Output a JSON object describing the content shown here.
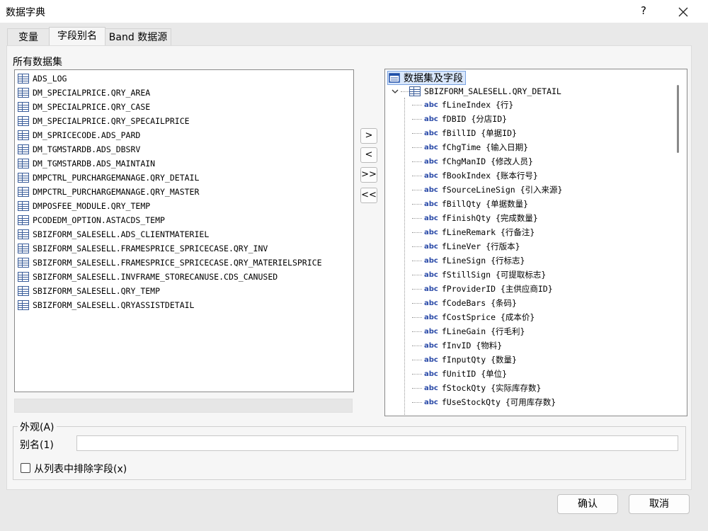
{
  "window": {
    "title": "数据字典",
    "help": "?",
    "close": "✕"
  },
  "tabs": [
    {
      "label": "变量"
    },
    {
      "label": "字段别名"
    },
    {
      "label": "Band 数据源"
    }
  ],
  "left_panel": {
    "label": "所有数据集",
    "datasets": [
      "ADS_LOG",
      "DM_SPECIALPRICE.QRY_AREA",
      "DM_SPECIALPRICE.QRY_CASE",
      "DM_SPECIALPRICE.QRY_SPECAILPRICE",
      "DM_SPRICECODE.ADS_PARD",
      "DM_TGMSTARDB.ADS_DBSRV",
      "DM_TGMSTARDB.ADS_MAINTAIN",
      "DMPCTRL_PURCHARGEMANAGE.QRY_DETAIL",
      "DMPCTRL_PURCHARGEMANAGE.QRY_MASTER",
      "DMPOSFEE_MODULE.QRY_TEMP",
      "PCODEDM_OPTION.ASTACDS_TEMP",
      "SBIZFORM_SALESELL.ADS_CLIENTMATERIEL",
      "SBIZFORM_SALESELL.FRAMESPRICE_SPRICECASE.QRY_INV",
      "SBIZFORM_SALESELL.FRAMESPRICE_SPRICECASE.QRY_MATERIELSPRICE",
      "SBIZFORM_SALESELL.INVFRAME_STORECANUSE.CDS_CANUSED",
      "SBIZFORM_SALESELL.QRY_TEMP",
      "SBIZFORM_SALESELL.QRYASSISTDETAIL"
    ]
  },
  "move_buttons": {
    "add": ">",
    "remove": "<",
    "add_all": ">>",
    "remove_all": "<<"
  },
  "right_panel": {
    "root_label": "数据集及字段",
    "node_label": "SBIZFORM_SALESELL.QRY_DETAIL",
    "type_tag": "abc",
    "fields": [
      "fLineIndex {行}",
      "fDBID {分店ID}",
      "fBillID {单据ID}",
      "fChgTime {输入日期}",
      "fChgManID {修改人员}",
      "fBookIndex {账本行号}",
      "fSourceLineSign {引入来源}",
      "fBillQty {单据数量}",
      "fFinishQty {完成数量}",
      "fLineRemark {行备注}",
      "fLineVer {行版本}",
      "fLineSign {行标志}",
      "fStillSign {可提取标志}",
      "fProviderID {主供应商ID}",
      "fCodeBars {条码}",
      "fCostSprice {成本价}",
      "fLineGain {行毛利}",
      "fInvID {物料}",
      "fInputQty {数量}",
      "fUnitID {单位}",
      "fStockQty {实际库存数}",
      "fUseStockQty {可用库存数}"
    ]
  },
  "appearance": {
    "group_label": "外观(A)",
    "alias_label": "别名(1)",
    "alias_value": "",
    "exclude_label": "从列表中排除字段(x)",
    "exclude_checked": false
  },
  "buttons": {
    "ok": "确认",
    "cancel": "取消"
  }
}
